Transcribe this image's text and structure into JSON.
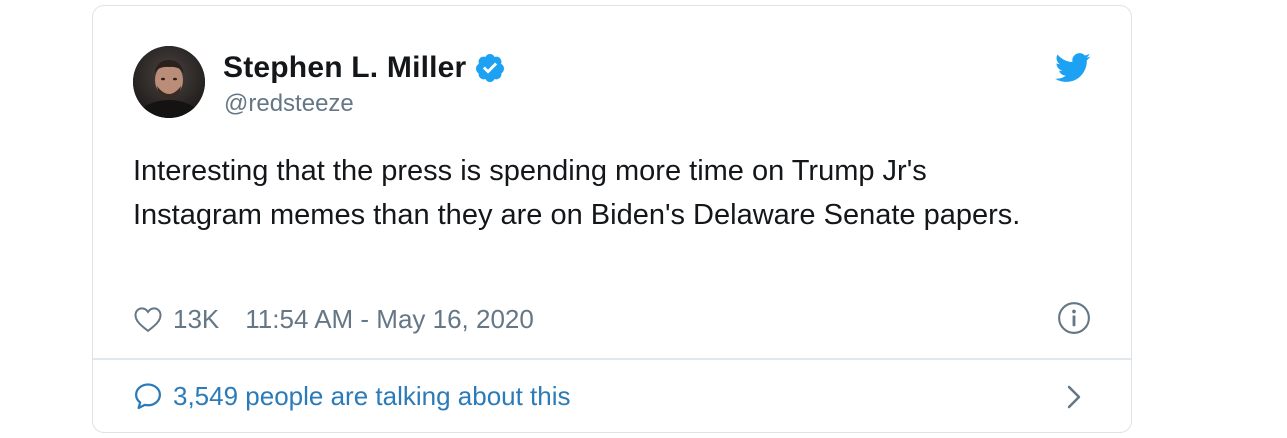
{
  "author": {
    "display_name": "Stephen L. Miller",
    "handle": "@redsteeze",
    "verified": true
  },
  "tweet": {
    "text": "Interesting that the press is spending more time on Trump Jr's Instagram memes than they are on Biden's Delaware Senate papers.",
    "likes": "13K",
    "timestamp": "11:54 AM - May 16, 2020"
  },
  "footer": {
    "talking": "3,549 people are talking about this"
  },
  "icons": {
    "brand": "twitter-bird-icon",
    "verified": "verified-badge-icon",
    "like": "heart-icon",
    "info": "info-icon",
    "reply": "speech-bubble-icon",
    "more": "chevron-right-icon"
  },
  "colors": {
    "twitter_blue": "#1da1f2",
    "link_blue": "#2b7bb9",
    "text": "#14171a",
    "secondary": "#657786",
    "border": "#dfe3e7"
  }
}
